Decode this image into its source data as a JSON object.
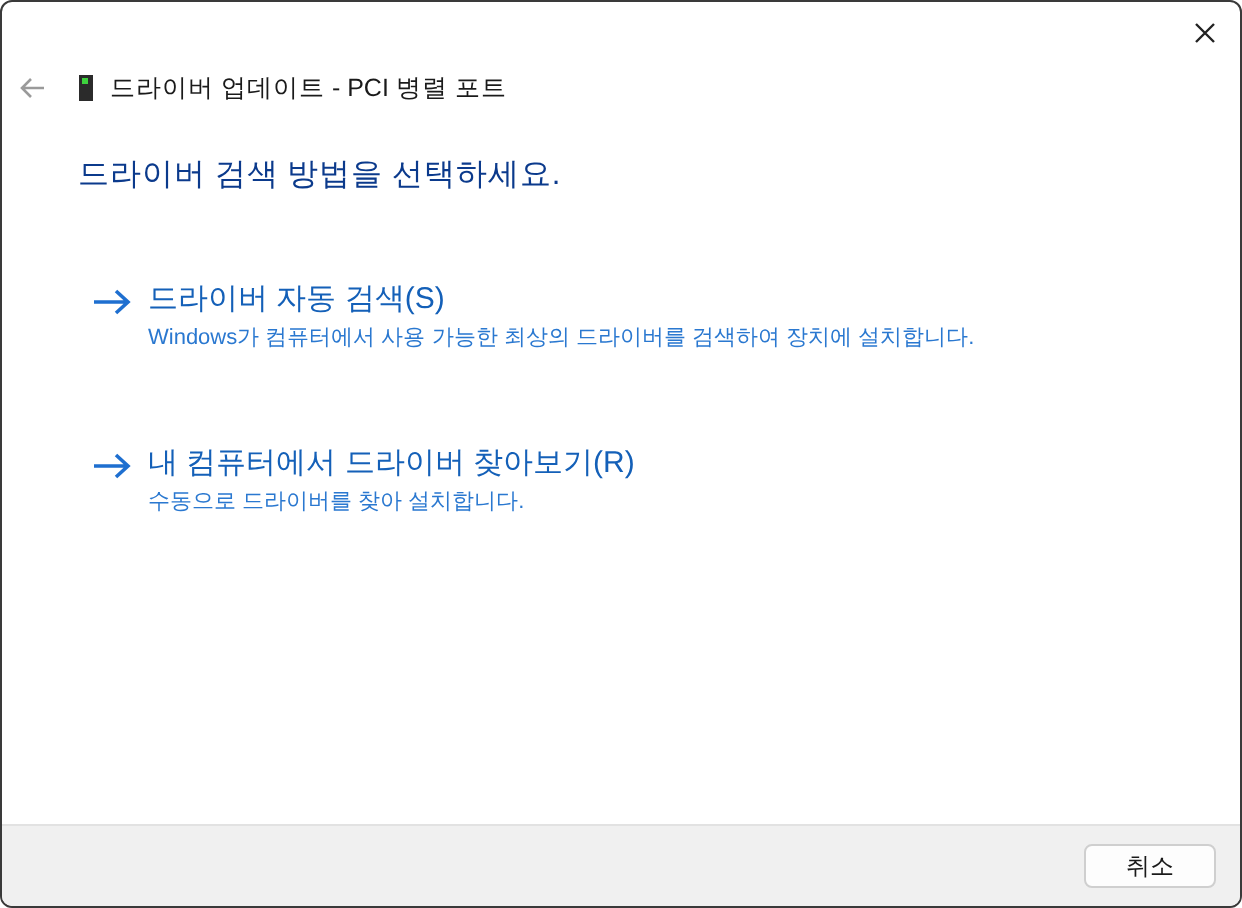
{
  "window": {
    "title": "드라이버 업데이트 - PCI 병렬 포트"
  },
  "heading": "드라이버 검색 방법을 선택하세요.",
  "options": [
    {
      "title": "드라이버 자동 검색(S)",
      "description": "Windows가 컴퓨터에서 사용 가능한 최상의 드라이버를 검색하여 장치에 설치합니다."
    },
    {
      "title": "내 컴퓨터에서 드라이버 찾아보기(R)",
      "description": "수동으로 드라이버를 찾아 설치합니다."
    }
  ],
  "buttons": [
    "취소"
  ]
}
